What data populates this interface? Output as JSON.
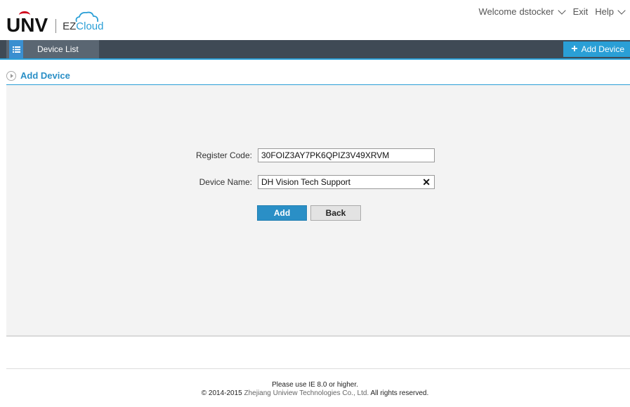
{
  "header": {
    "logo_brand": "UNV",
    "logo_ez": "EZ",
    "logo_cloud": "Cloud",
    "welcome_label": "Welcome",
    "username": "dstocker",
    "exit_label": "Exit",
    "help_label": "Help"
  },
  "navbar": {
    "device_list_label": "Device List",
    "add_device_label": "Add Device",
    "accent_color": "#2a9fd6"
  },
  "page": {
    "title": "Add Device"
  },
  "form": {
    "register_code_label": "Register Code:",
    "register_code_value": "30FOIZ3AY7PK6QPIZ3V49XRVM",
    "device_name_label": "Device Name:",
    "device_name_value": "DH Vision Tech Support",
    "clear_symbol": "✕",
    "add_button": "Add",
    "back_button": "Back"
  },
  "footer": {
    "browser_note": "Please use IE 8.0 or higher.",
    "copyright_prefix": "© 2014-2015",
    "company": "Zhejiang Uniview Technologies Co., Ltd.",
    "rights": "All rights reserved."
  }
}
